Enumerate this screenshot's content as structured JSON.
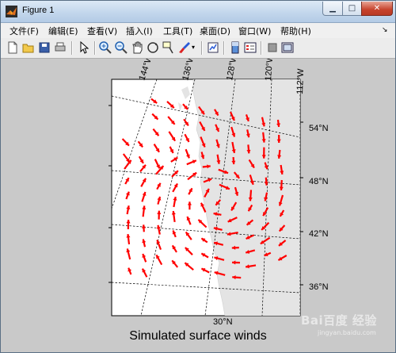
{
  "window": {
    "title": "Figure 1",
    "minimize": "▁",
    "maximize": "□",
    "close": "✕"
  },
  "menu": [
    "文件(F)",
    "编辑(E)",
    "查看(V)",
    "插入(I)",
    "工具(T)",
    "桌面(D)",
    "窗口(W)",
    "帮助(H)"
  ],
  "toolbar": [
    "new-figure-icon",
    "open-file-icon",
    "save-icon",
    "print-icon",
    "edit-plot-arrow-icon",
    "zoom-in-icon",
    "zoom-out-icon",
    "pan-hand-icon",
    "rotate-3d-icon",
    "data-cursor-icon",
    "brush-icon",
    "brush-dropdown-icon",
    "link-plot-icon",
    "insert-colorbar-icon",
    "insert-legend-icon",
    "hide-plot-tools-icon",
    "show-plot-tools-icon"
  ],
  "map": {
    "lon_labels": [
      "144°W",
      "136°W",
      "128°W",
      "120°W",
      "112°W"
    ],
    "lat_labels": [
      "54°N",
      "48°N",
      "42°N",
      "36°N",
      "30°N"
    ],
    "caption": "Simulated surface winds",
    "vector_color": "#ff0000",
    "land_color": "#e4e4e4",
    "ocean_color": "#ffffff"
  },
  "watermark": {
    "text": "Bai百度 经验",
    "sub": "jingyan.baidu.com"
  }
}
